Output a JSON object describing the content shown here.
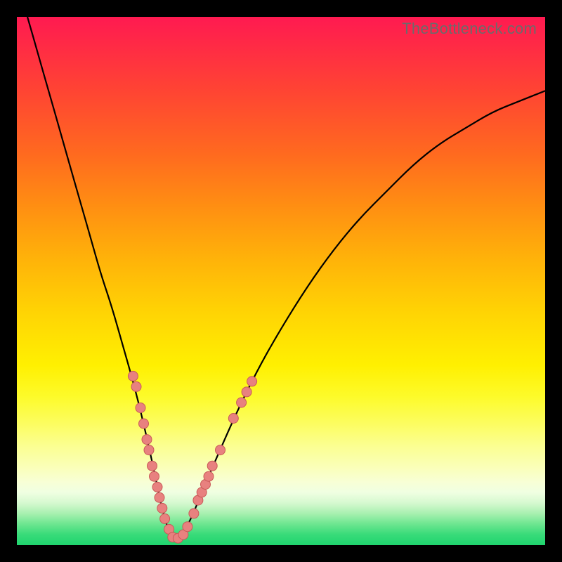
{
  "watermark_text": "TheBottleneck.com",
  "chart_data": {
    "type": "line",
    "title": "",
    "xlabel": "",
    "ylabel": "",
    "xlim": [
      0,
      100
    ],
    "ylim": [
      0,
      100
    ],
    "curve": {
      "name": "bottleneck-curve",
      "x": [
        2,
        4,
        6,
        8,
        10,
        12,
        14,
        16,
        18,
        20,
        22,
        24,
        26,
        27,
        28,
        29,
        30,
        31,
        33,
        35,
        38,
        42,
        46,
        50,
        55,
        60,
        65,
        70,
        75,
        80,
        85,
        90,
        95,
        100
      ],
      "y": [
        100,
        93,
        86,
        79,
        72,
        65,
        58,
        51,
        45,
        38,
        31,
        23,
        14,
        9,
        5,
        2,
        1,
        1.5,
        5,
        10,
        17,
        26,
        34,
        41,
        49,
        56,
        62,
        67,
        72,
        76,
        79,
        82,
        84,
        86
      ]
    },
    "data_points": {
      "name": "measured-points",
      "points": [
        {
          "x": 22.0,
          "y": 32
        },
        {
          "x": 22.6,
          "y": 30
        },
        {
          "x": 23.4,
          "y": 26
        },
        {
          "x": 24.0,
          "y": 23
        },
        {
          "x": 24.6,
          "y": 20
        },
        {
          "x": 25.0,
          "y": 18
        },
        {
          "x": 25.6,
          "y": 15
        },
        {
          "x": 26.0,
          "y": 13
        },
        {
          "x": 26.6,
          "y": 11
        },
        {
          "x": 27.0,
          "y": 9
        },
        {
          "x": 27.5,
          "y": 7
        },
        {
          "x": 28.0,
          "y": 5
        },
        {
          "x": 28.8,
          "y": 3
        },
        {
          "x": 29.5,
          "y": 1.5
        },
        {
          "x": 30.5,
          "y": 1.3
        },
        {
          "x": 31.5,
          "y": 2
        },
        {
          "x": 32.3,
          "y": 3.5
        },
        {
          "x": 33.5,
          "y": 6
        },
        {
          "x": 34.3,
          "y": 8.5
        },
        {
          "x": 35.0,
          "y": 10
        },
        {
          "x": 35.7,
          "y": 11.5
        },
        {
          "x": 36.3,
          "y": 13
        },
        {
          "x": 37.0,
          "y": 15
        },
        {
          "x": 38.5,
          "y": 18
        },
        {
          "x": 41.0,
          "y": 24
        },
        {
          "x": 42.5,
          "y": 27
        },
        {
          "x": 43.5,
          "y": 29
        },
        {
          "x": 44.5,
          "y": 31
        }
      ]
    },
    "background_gradient": {
      "top": "#ff1a51",
      "mid": "#fff001",
      "bottom": "#1fd46e"
    }
  }
}
